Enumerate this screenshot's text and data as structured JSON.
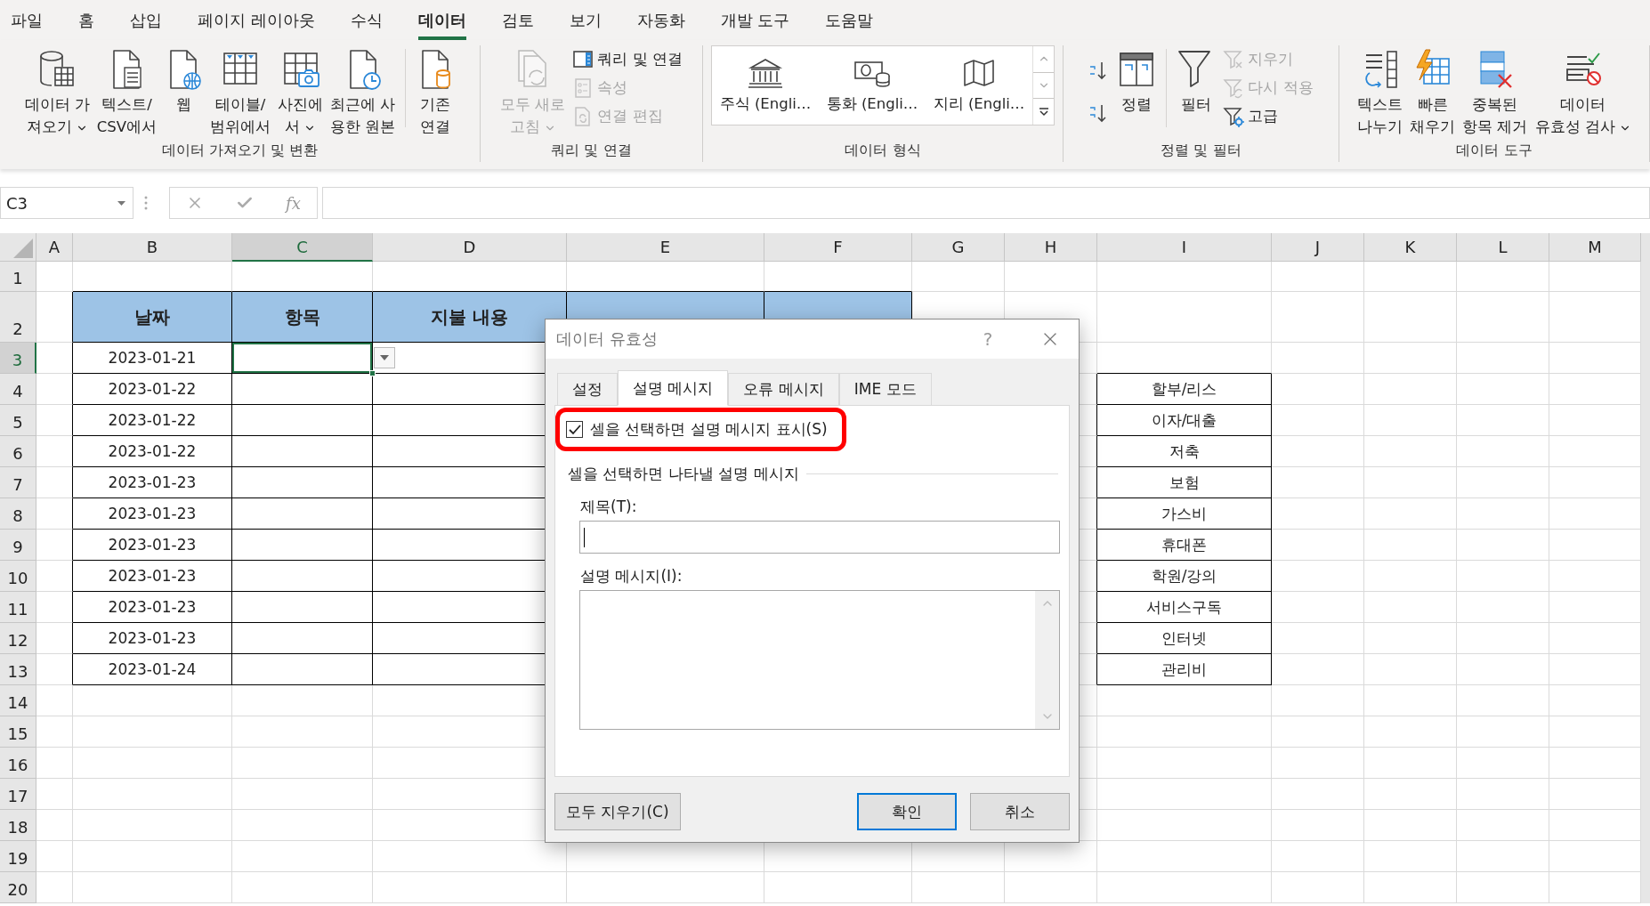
{
  "tabs": [
    {
      "label": "파일",
      "selected": false
    },
    {
      "label": "홈",
      "selected": false
    },
    {
      "label": "삽입",
      "selected": false
    },
    {
      "label": "페이지 레이아웃",
      "selected": false
    },
    {
      "label": "수식",
      "selected": false
    },
    {
      "label": "데이터",
      "selected": true
    },
    {
      "label": "검토",
      "selected": false
    },
    {
      "label": "보기",
      "selected": false
    },
    {
      "label": "자동화",
      "selected": false
    },
    {
      "label": "개발 도구",
      "selected": false
    },
    {
      "label": "도움말",
      "selected": false
    }
  ],
  "ribbon": {
    "groups": [
      {
        "label": "데이터 가져오기 및 변환",
        "items": [
          {
            "kind": "large",
            "lines": [
              "데이터 가",
              "져오기"
            ],
            "has_menu": true,
            "disabled": false,
            "divider_before": false
          },
          {
            "kind": "large",
            "lines": [
              "텍스트/",
              "CSV에서"
            ],
            "has_menu": false,
            "disabled": false,
            "divider_before": false
          },
          {
            "kind": "large",
            "lines": [
              "웹"
            ],
            "has_menu": false,
            "disabled": false,
            "divider_before": false
          },
          {
            "kind": "large",
            "lines": [
              "테이블/",
              "범위에서"
            ],
            "has_menu": false,
            "disabled": false,
            "divider_before": false
          },
          {
            "kind": "large",
            "lines": [
              "사진에",
              "서"
            ],
            "has_menu": true,
            "disabled": false,
            "divider_before": false
          },
          {
            "kind": "large",
            "lines": [
              "최근에 사",
              "용한 원본"
            ],
            "has_menu": false,
            "disabled": false,
            "divider_before": false
          },
          {
            "kind": "large",
            "lines": [
              "기존",
              "연결"
            ],
            "has_menu": false,
            "disabled": false,
            "divider_before": true
          }
        ]
      },
      {
        "label": "쿼리 및 연결",
        "items": [
          {
            "kind": "large",
            "lines": [
              "모두 새로",
              "고침"
            ],
            "has_menu": true,
            "disabled": true,
            "divider_before": false
          },
          {
            "kind": "stack",
            "items": [
              {
                "label": "쿼리 및 연결",
                "disabled": false
              },
              {
                "label": "속성",
                "disabled": true
              },
              {
                "label": "연결 편집",
                "disabled": true
              }
            ]
          }
        ]
      },
      {
        "label": "데이터 형식",
        "items": [
          {
            "kind": "gallery",
            "items": [
              {
                "label": "주식 (Engli…"
              },
              {
                "label": "통화 (Engli…"
              },
              {
                "label": "지리 (Engli…"
              }
            ]
          }
        ]
      },
      {
        "label": "정렬 및 필터",
        "items": [
          {
            "kind": "stack",
            "items": [
              {
                "disabled": false
              },
              {
                "disabled": false
              }
            ]
          },
          {
            "kind": "large",
            "lines": [
              "정렬"
            ],
            "has_menu": false,
            "disabled": false,
            "divider_before": false
          },
          {
            "kind": "large",
            "lines": [
              "필터"
            ],
            "has_menu": false,
            "disabled": false,
            "divider_before": true
          },
          {
            "kind": "stack",
            "items": [
              {
                "label": "지우기",
                "disabled": true
              },
              {
                "label": "다시 적용",
                "disabled": true
              },
              {
                "label": "고급",
                "disabled": false
              }
            ]
          }
        ]
      },
      {
        "label": "데이터 도구",
        "items": [
          {
            "kind": "large",
            "lines": [
              "텍스트",
              "나누기"
            ],
            "has_menu": false,
            "disabled": false,
            "divider_before": false
          },
          {
            "kind": "large",
            "lines": [
              "빠른",
              "채우기"
            ],
            "has_menu": false,
            "disabled": false,
            "divider_before": false
          },
          {
            "kind": "large",
            "lines": [
              "중복된",
              "항목 제거"
            ],
            "has_menu": false,
            "disabled": false,
            "divider_before": false
          },
          {
            "kind": "large",
            "lines": [
              "데이터",
              "유효성 검사"
            ],
            "has_menu": true,
            "disabled": false,
            "divider_before": false
          }
        ]
      }
    ]
  },
  "formula_bar": {
    "name_box": "C3",
    "function_label": "fx"
  },
  "sheet": {
    "columns": [
      {
        "label": "A",
        "selected": false
      },
      {
        "label": "B",
        "selected": false
      },
      {
        "label": "C",
        "selected": true
      },
      {
        "label": "D",
        "selected": false
      },
      {
        "label": "E",
        "selected": false
      },
      {
        "label": "F",
        "selected": false
      },
      {
        "label": "G",
        "selected": false
      },
      {
        "label": "H",
        "selected": false
      },
      {
        "label": "I",
        "selected": false
      },
      {
        "label": "J",
        "selected": false
      },
      {
        "label": "K",
        "selected": false
      },
      {
        "label": "L",
        "selected": false
      },
      {
        "label": "M",
        "selected": false
      }
    ],
    "rows": [
      {
        "label": "1",
        "selected": false
      },
      {
        "label": "2",
        "selected": false
      },
      {
        "label": "3",
        "selected": true
      },
      {
        "label": "4",
        "selected": false
      },
      {
        "label": "5",
        "selected": false
      },
      {
        "label": "6",
        "selected": false
      },
      {
        "label": "7",
        "selected": false
      },
      {
        "label": "8",
        "selected": false
      },
      {
        "label": "9",
        "selected": false
      },
      {
        "label": "10",
        "selected": false
      },
      {
        "label": "11",
        "selected": false
      },
      {
        "label": "12",
        "selected": false
      },
      {
        "label": "13",
        "selected": false
      },
      {
        "label": "14",
        "selected": false
      },
      {
        "label": "15",
        "selected": false
      },
      {
        "label": "16",
        "selected": false
      },
      {
        "label": "17",
        "selected": false
      },
      {
        "label": "18",
        "selected": false
      },
      {
        "label": "19",
        "selected": false
      },
      {
        "label": "20",
        "selected": false
      }
    ],
    "table": {
      "headers": [
        "날짜",
        "항목",
        "지불 내용"
      ],
      "rows": [
        {
          "date": "2023-01-21",
          "item_selected": true
        },
        {
          "date": "2023-01-22",
          "item_selected": false
        },
        {
          "date": "2023-01-22",
          "item_selected": false
        },
        {
          "date": "2023-01-22",
          "item_selected": false
        },
        {
          "date": "2023-01-23",
          "item_selected": false
        },
        {
          "date": "2023-01-23",
          "item_selected": false
        },
        {
          "date": "2023-01-23",
          "item_selected": false
        },
        {
          "date": "2023-01-23",
          "item_selected": false
        },
        {
          "date": "2023-01-23",
          "item_selected": false
        },
        {
          "date": "2023-01-23",
          "item_selected": false
        },
        {
          "date": "2023-01-24",
          "item_selected": false
        }
      ]
    },
    "categories": [
      "할부/리스",
      "이자/대출",
      "저축",
      "보험",
      "가스비",
      "휴대폰",
      "학원/강의",
      "서비스구독",
      "인터넷",
      "관리비"
    ]
  },
  "dialog": {
    "title": "데이터 유효성",
    "help": "?",
    "tabs": [
      {
        "label": "설정",
        "selected": false
      },
      {
        "label": "설명 메시지",
        "selected": true
      },
      {
        "label": "오류 메시지",
        "selected": false
      },
      {
        "label": "IME 모드",
        "selected": false
      }
    ],
    "show_message": {
      "label": "셀을 선택하면 설명 메시지 표시(S)",
      "checked": true
    },
    "section": "셀을 선택하면 나타낼 설명 메시지",
    "title_field": {
      "label": "제목(T):"
    },
    "message_field": {
      "label": "설명 메시지(I):"
    },
    "buttons": [
      {
        "label": "모두 지우기(C)",
        "default": false
      },
      {
        "label": "확인",
        "default": true
      },
      {
        "label": "취소",
        "default": false
      }
    ]
  }
}
